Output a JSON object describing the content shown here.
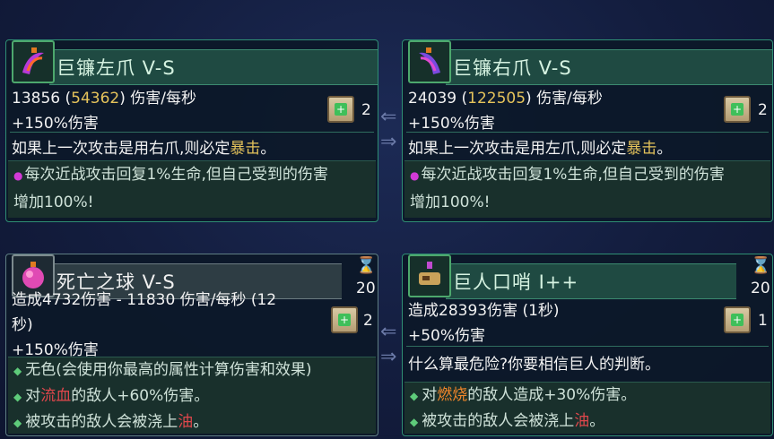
{
  "cards": [
    {
      "title": "巨镰左爪 V-S",
      "dps_base": "13856",
      "dps_open": "(",
      "dps_crit": "54362",
      "dps_close": ")",
      "dps_unit": "伤害/每秒",
      "bonus": "+150%伤害",
      "desc_pre": "如果上一次攻击是用右爪,则必定",
      "desc_kw": "暴击",
      "desc_post": "。",
      "effect_line1": "每次近战攻击回复1%生命,但自己受到的伤害",
      "effect_line2": "增加100%!",
      "scroll_count": "2",
      "icon": "scythe-claw-icon"
    },
    {
      "title": "巨镰右爪 V-S",
      "dps_base": "24039",
      "dps_open": "(",
      "dps_crit": "122505",
      "dps_close": ")",
      "dps_unit": "伤害/每秒",
      "bonus": "+150%伤害",
      "desc_pre": "如果上一次攻击是用左爪,则必定",
      "desc_kw": "暴击",
      "desc_post": "。",
      "effect_line1": "每次近战攻击回复1%生命,但自己受到的伤害",
      "effect_line2": "增加100%!",
      "scroll_count": "2",
      "icon": "scythe-claw-icon"
    },
    {
      "title": "死亡之球 V-S",
      "dmg_line1": "造成4732伤害 - 11830 伤害/每秒 (12",
      "dmg_line2": "秒)",
      "bonus": "+150%伤害",
      "fx1": "无色(会使用你最高的属性计算伤害和效果)",
      "fx2_pre": "对",
      "fx2_kw": "流血",
      "fx2_post": "的敌人+60%伤害。",
      "fx3_pre": "被攻击的敌人会被浇上",
      "fx3_kw": "油",
      "fx3_post": "。",
      "cooldown": "20",
      "scroll_count": "2",
      "icon": "death-orb-icon"
    },
    {
      "title": "巨人口哨 I++",
      "dmg_line1": "造成28393伤害 (1秒)",
      "bonus": "+50%伤害",
      "desc": "什么算最危险?你要相信巨人的判断。",
      "fx1_pre": "对",
      "fx1_kw": "燃烧",
      "fx1_post": "的敌人造成+30%伤害。",
      "fx2_pre": "被攻击的敌人会被浇上",
      "fx2_kw": "油",
      "fx2_post": "。",
      "cooldown": "20",
      "scroll_count": "1",
      "icon": "giant-whistle-icon"
    }
  ],
  "colors": {
    "keyword": "#e5c35b",
    "bleed": "#e0474c",
    "burn": "#f0862a",
    "oil": "#e0474c"
  }
}
